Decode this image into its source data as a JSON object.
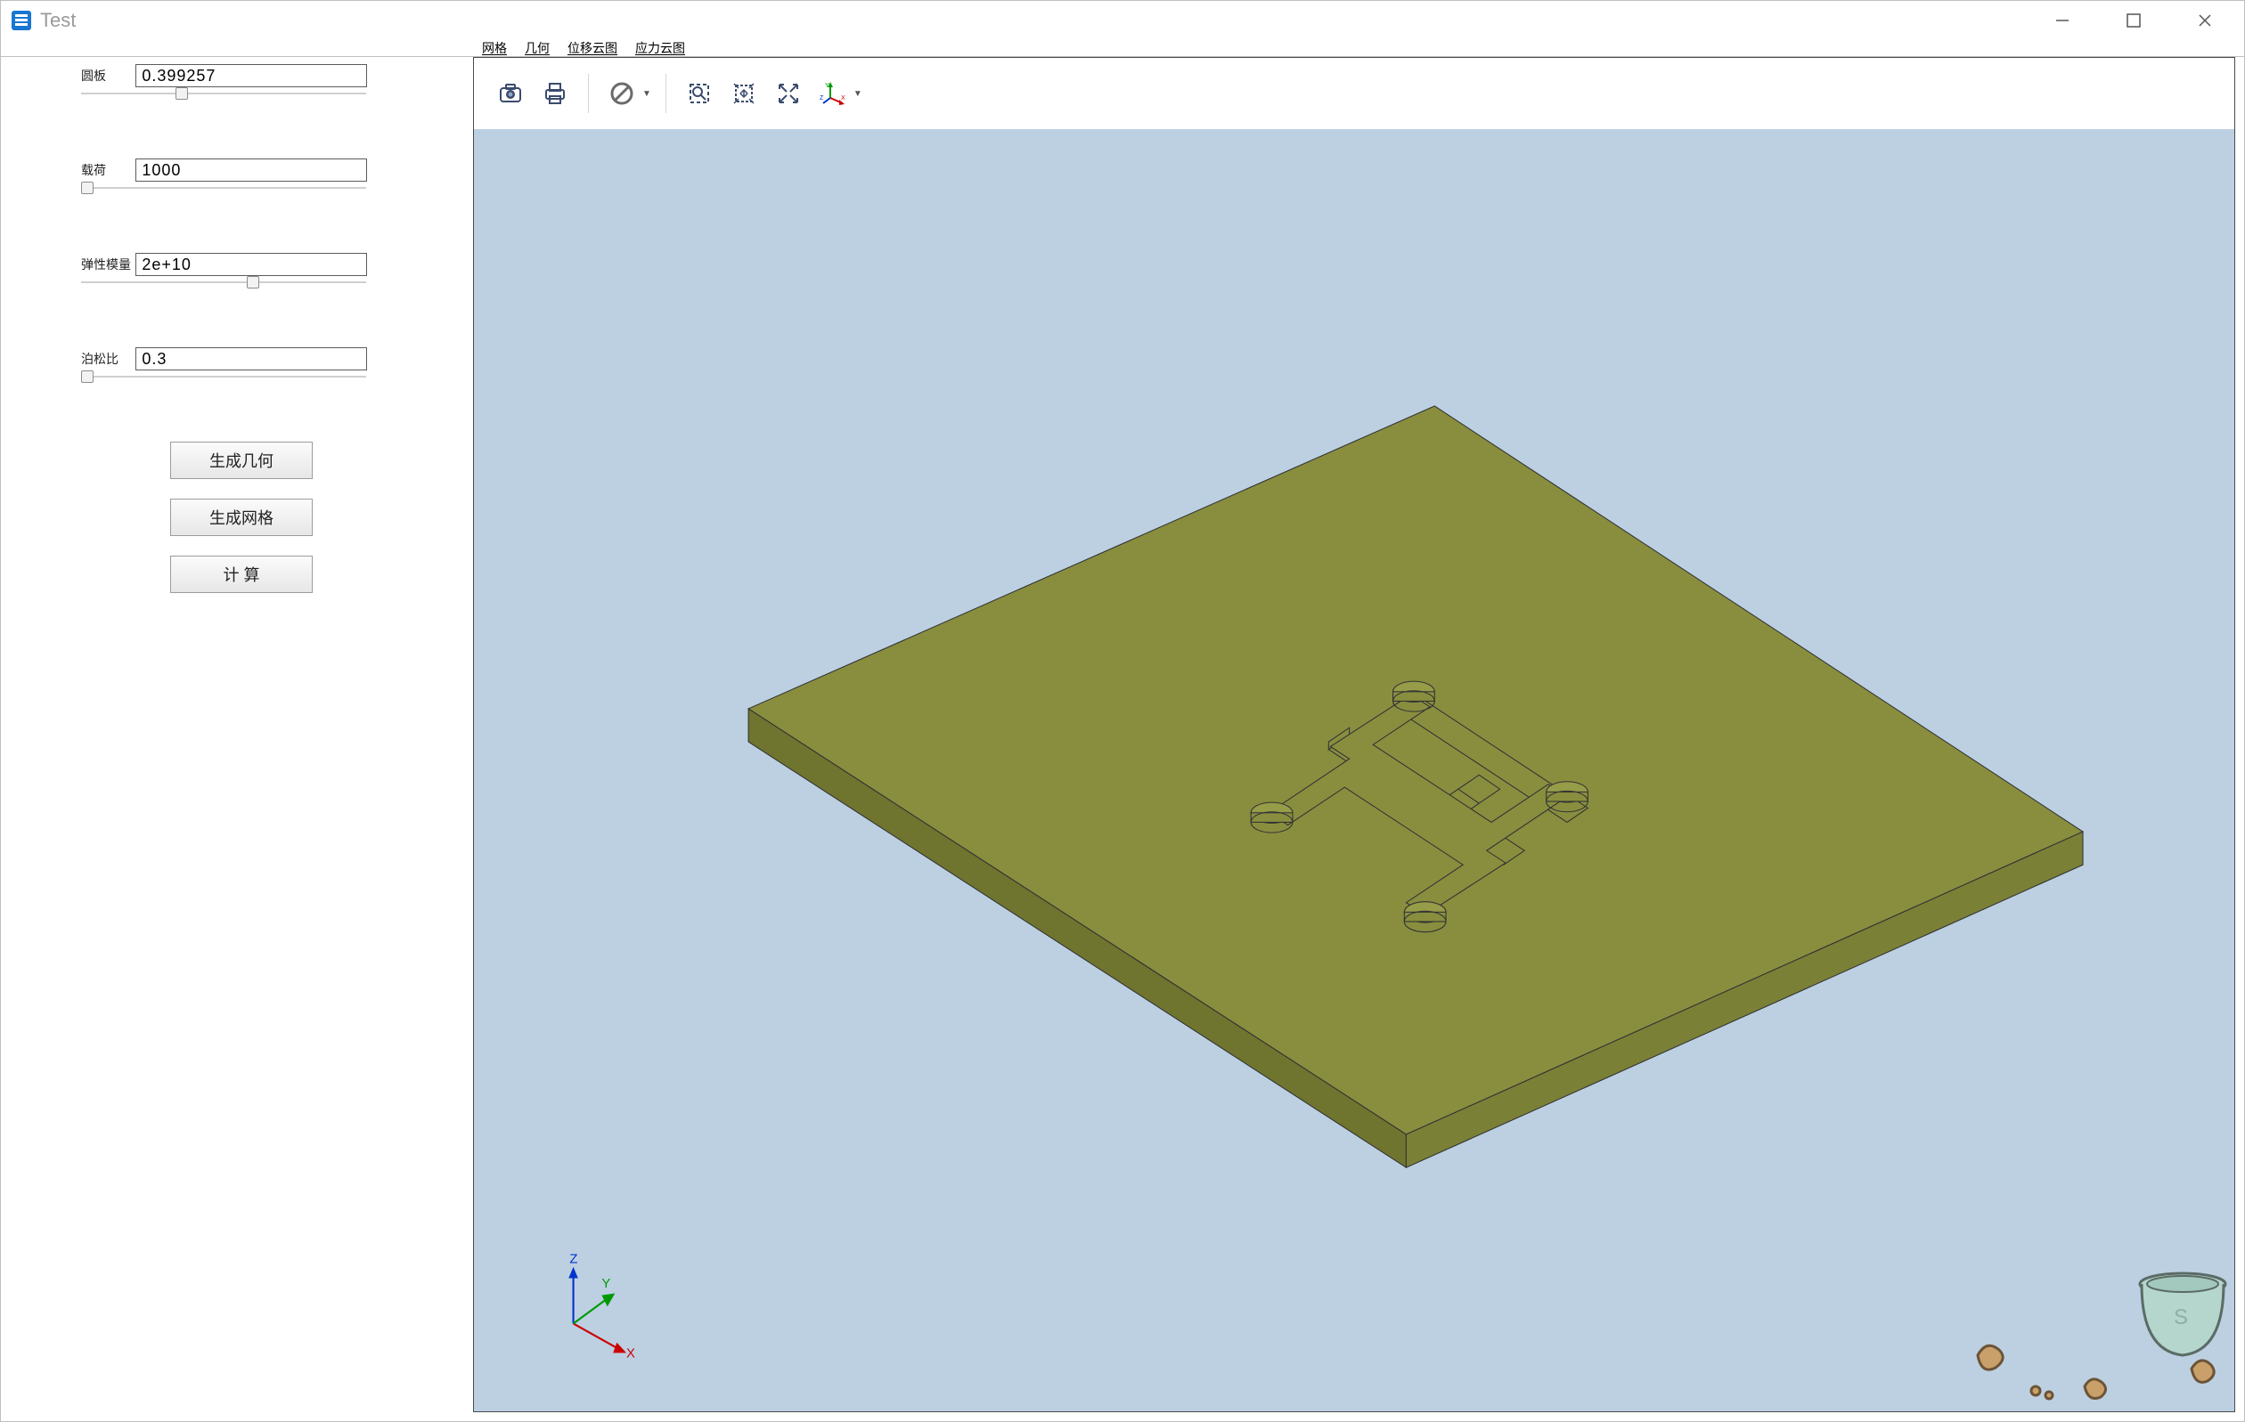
{
  "window": {
    "title": "Test"
  },
  "menu": {
    "items": [
      "网格",
      "几何",
      "位移云图",
      "应力云图"
    ]
  },
  "parameters": [
    {
      "label": "圆板",
      "value": "0.399257",
      "handle_pct": 33
    },
    {
      "label": "载荷",
      "value": "1000",
      "handle_pct": 0
    },
    {
      "label": "弹性模量",
      "value": "2e+10",
      "handle_pct": 58
    },
    {
      "label": "泊松比",
      "value": "0.3",
      "handle_pct": 0
    }
  ],
  "buttons": {
    "generate_geometry": "生成几何",
    "generate_mesh": "生成网格",
    "calculate": "计 算"
  },
  "toolbar_icons": {
    "camera": "camera-icon",
    "print": "print-icon",
    "clear": "clear-icon",
    "select_box": "select-box-icon",
    "fit": "fit-view-icon",
    "reset": "reset-view-icon",
    "axis": "axis-icon"
  }
}
